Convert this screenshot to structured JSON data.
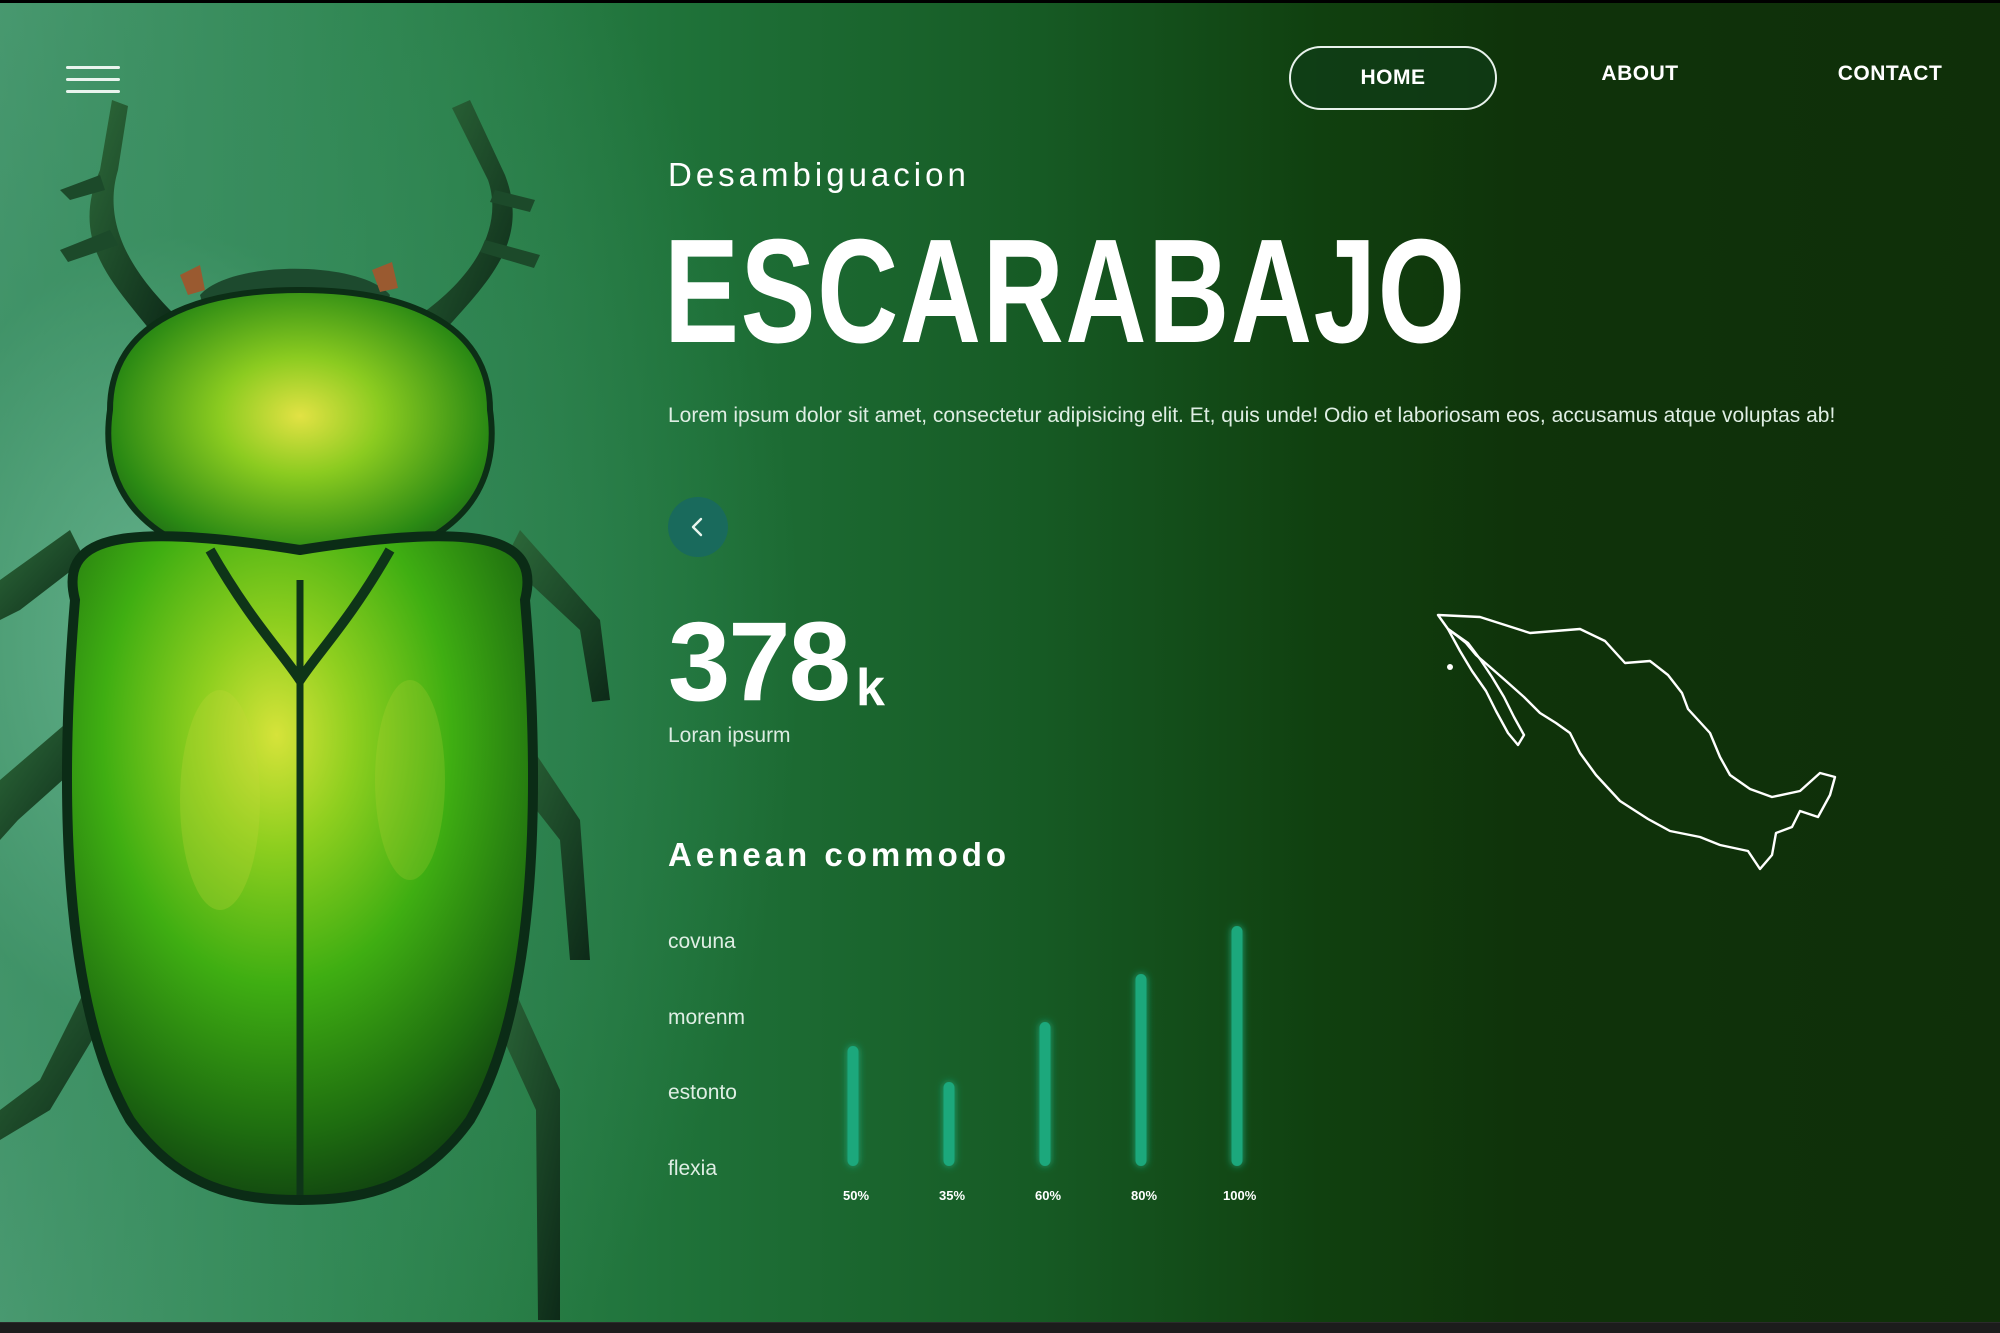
{
  "nav": {
    "home": "HOME",
    "about": "ABOUT",
    "contact": "CONTACT"
  },
  "hero": {
    "subtitle": "Desambiguacion",
    "title": "ESCARABAJO",
    "description": "Lorem ipsum dolor sit amet, consectetur adipisicing elit. Et, quis unde! Odio et laboriosam eos, accusamus atque voluptas ab!"
  },
  "stat": {
    "value": "378",
    "unit": "k",
    "label": "Loran ipsurm"
  },
  "section": {
    "title": "Aenean commodo",
    "labels": [
      "covuna",
      "morenm",
      "estonto",
      "flexia"
    ]
  },
  "icons": {
    "menu": "hamburger-menu-icon",
    "prev": "chevron-left-icon",
    "map": "mexico-map-outline"
  },
  "colors": {
    "accent": "#1aa87c",
    "button_bg": "#196a5c"
  },
  "chart_data": {
    "type": "bar",
    "categories": [
      "50%",
      "35%",
      "60%",
      "80%",
      "100%"
    ],
    "values": [
      50,
      35,
      60,
      80,
      100
    ],
    "title": "",
    "xlabel": "",
    "ylabel": "",
    "ylim": [
      0,
      100
    ]
  }
}
